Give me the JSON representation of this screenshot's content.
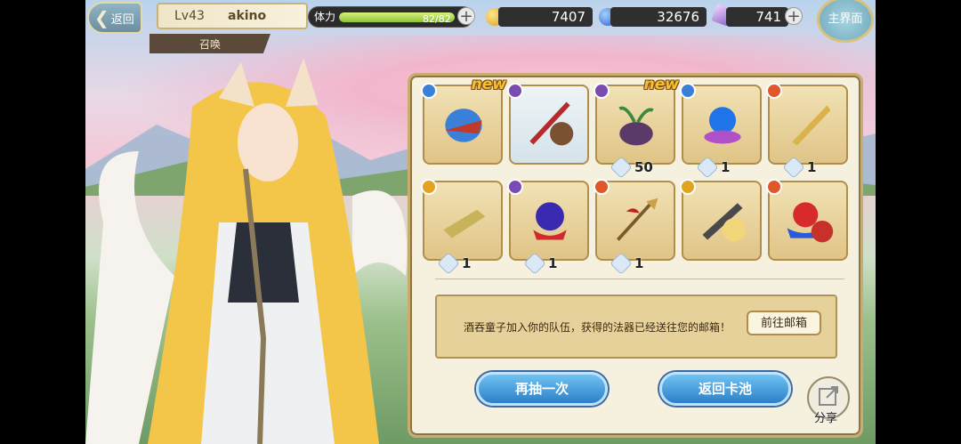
{
  "top_bar": {
    "back_label": "返回",
    "level": "Lv43",
    "player_name": "akino",
    "summon_tab": "召唤",
    "stamina_label": "体力",
    "stamina_value": "82/82",
    "stamina_fraction": 1.0,
    "gold": "7407",
    "blue_gems": "32676",
    "crystals": "741",
    "home_label": "主界面"
  },
  "results": {
    "slots": [
      {
        "element": "blue",
        "item": "blue-dragon-shield",
        "new": "new",
        "count": ""
      },
      {
        "element": "purple",
        "item": "sword-with-character",
        "new": "",
        "count": ""
      },
      {
        "element": "purple",
        "item": "plant-pot",
        "new": "new",
        "count": "50"
      },
      {
        "element": "blue",
        "item": "blue-orb",
        "new": "",
        "count": "1"
      },
      {
        "element": "red",
        "item": "golden-blade",
        "new": "",
        "count": "1"
      },
      {
        "element": "gold",
        "item": "gold-bar",
        "new": "",
        "count": "1"
      },
      {
        "element": "purple",
        "item": "purple-orb",
        "new": "",
        "count": "1"
      },
      {
        "element": "red",
        "item": "red-spear",
        "new": "",
        "count": "1"
      },
      {
        "element": "gold",
        "item": "knife-with-character",
        "new": "",
        "count": ""
      },
      {
        "element": "red",
        "item": "red-orb-with-character",
        "new": "",
        "count": ""
      }
    ],
    "message": "酒吞童子加入你的队伍，获得的法器已经送往您的邮箱！",
    "mail_button": "前往邮箱",
    "draw_again": "再抽一次",
    "return_pool": "返回卡池",
    "share": "分享"
  },
  "colors": {
    "element_blue": "#3a7fd8",
    "element_purple": "#7a4bb0",
    "element_red": "#e0572a",
    "element_gold": "#e2a321",
    "button_blue": "#2d7fc8"
  }
}
